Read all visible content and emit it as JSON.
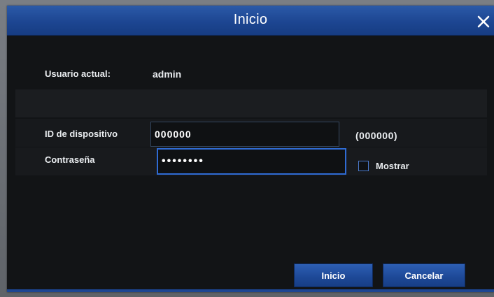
{
  "dialog": {
    "title": "Inicio",
    "close_icon": "close-icon"
  },
  "user": {
    "label": "Usuario actual:",
    "value": "admin"
  },
  "device": {
    "label": "ID de dispositivo",
    "value": "000000",
    "hint": "(000000)"
  },
  "password": {
    "label": "Contraseña",
    "value": "••••••••",
    "show_label": "Mostrar",
    "show_checked": false
  },
  "buttons": {
    "login": "Inicio",
    "cancel": "Cancelar"
  },
  "colors": {
    "title_bar": "#1d4692",
    "background": "#121416",
    "accent": "#2f6bd3"
  }
}
